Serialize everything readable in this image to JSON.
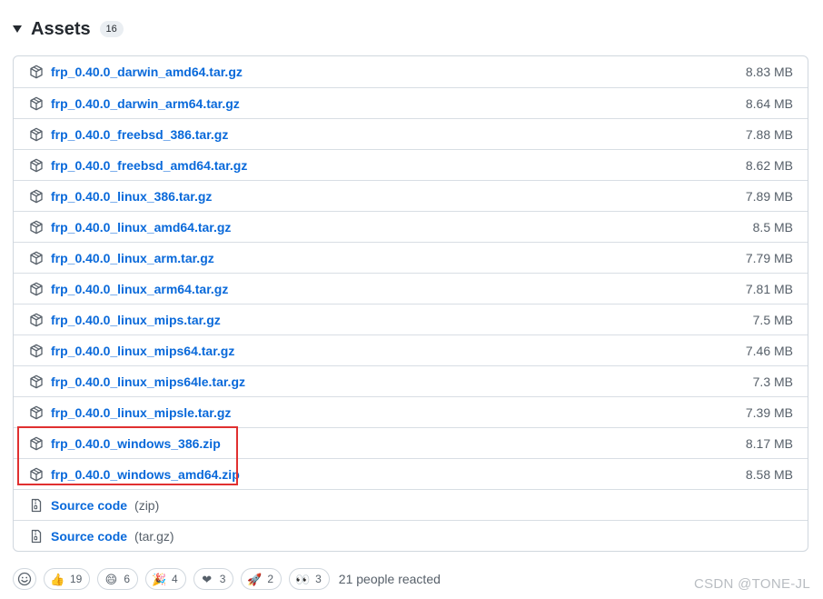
{
  "header": {
    "title": "Assets",
    "count": "16"
  },
  "assets": [
    {
      "name": "frp_0.40.0_darwin_amd64.tar.gz",
      "size": "8.83 MB"
    },
    {
      "name": "frp_0.40.0_darwin_arm64.tar.gz",
      "size": "8.64 MB"
    },
    {
      "name": "frp_0.40.0_freebsd_386.tar.gz",
      "size": "7.88 MB"
    },
    {
      "name": "frp_0.40.0_freebsd_amd64.tar.gz",
      "size": "8.62 MB"
    },
    {
      "name": "frp_0.40.0_linux_386.tar.gz",
      "size": "7.89 MB"
    },
    {
      "name": "frp_0.40.0_linux_amd64.tar.gz",
      "size": "8.5 MB"
    },
    {
      "name": "frp_0.40.0_linux_arm.tar.gz",
      "size": "7.79 MB"
    },
    {
      "name": "frp_0.40.0_linux_arm64.tar.gz",
      "size": "7.81 MB"
    },
    {
      "name": "frp_0.40.0_linux_mips.tar.gz",
      "size": "7.5 MB"
    },
    {
      "name": "frp_0.40.0_linux_mips64.tar.gz",
      "size": "7.46 MB"
    },
    {
      "name": "frp_0.40.0_linux_mips64le.tar.gz",
      "size": "7.3 MB"
    },
    {
      "name": "frp_0.40.0_linux_mipsle.tar.gz",
      "size": "7.39 MB"
    },
    {
      "name": "frp_0.40.0_windows_386.zip",
      "size": "8.17 MB"
    },
    {
      "name": "frp_0.40.0_windows_amd64.zip",
      "size": "8.58 MB"
    }
  ],
  "source": [
    {
      "label": "Source code",
      "suffix": "(zip)"
    },
    {
      "label": "Source code",
      "suffix": "(tar.gz)"
    }
  ],
  "reactions": {
    "items": [
      {
        "icon": "thumbs-up-icon",
        "emoji": "👍",
        "count": "19"
      },
      {
        "icon": "laugh-icon",
        "emoji": "😄",
        "count": "6"
      },
      {
        "icon": "hooray-icon",
        "emoji": "🎉",
        "count": "4"
      },
      {
        "icon": "heart-icon",
        "emoji": "❤",
        "count": "3"
      },
      {
        "icon": "rocket-icon",
        "emoji": "🚀",
        "count": "2"
      },
      {
        "icon": "eyes-icon",
        "emoji": "👀",
        "count": "3"
      }
    ],
    "summary": "21 people reacted"
  },
  "watermark": "CSDN @TONE-JL",
  "colors": {
    "link": "#0969da",
    "highlight": "#e03030"
  }
}
